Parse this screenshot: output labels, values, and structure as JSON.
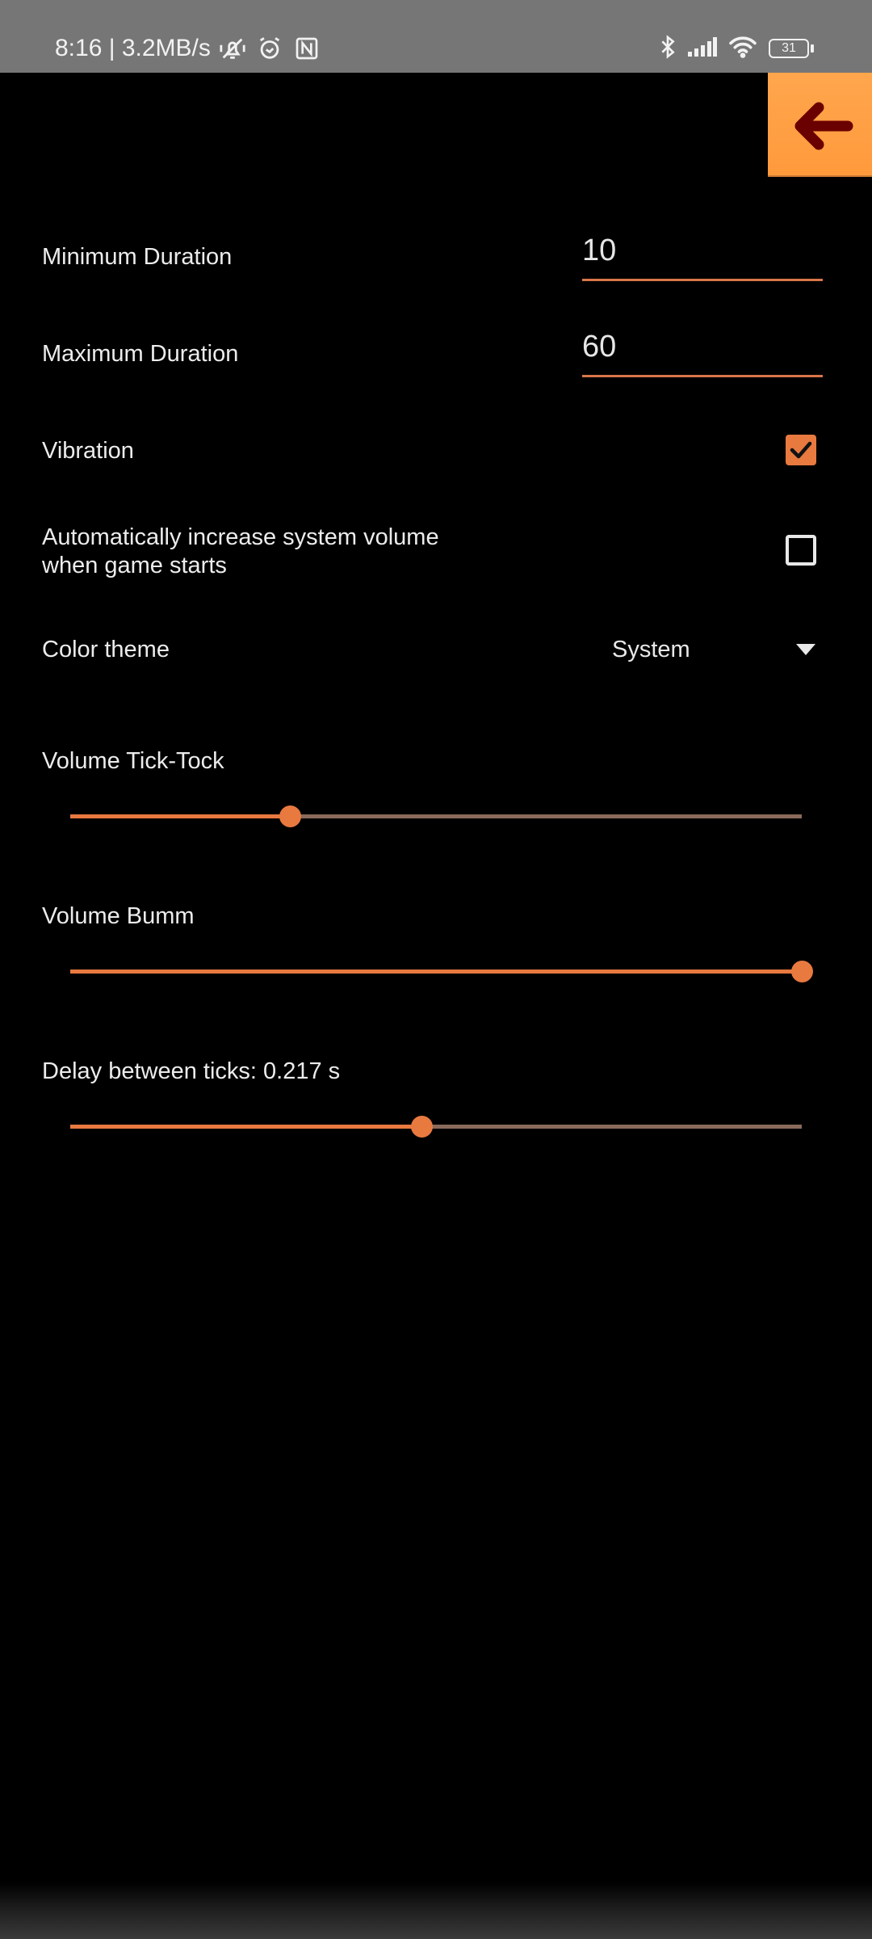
{
  "status_bar": {
    "time_speed": "8:16 | 3.2MB/s",
    "battery": "31",
    "icons": [
      "vibrate-off-icon",
      "alarm-icon",
      "nfc-icon",
      "bluetooth-icon",
      "signal-icon",
      "wifi-icon",
      "battery-icon"
    ]
  },
  "header": {
    "back_icon": "arrow-left-icon"
  },
  "settings": {
    "min_duration": {
      "label": "Minimum Duration",
      "value": "10"
    },
    "max_duration": {
      "label": "Maximum Duration",
      "value": "60"
    },
    "vibration": {
      "label": "Vibration",
      "checked": true
    },
    "auto_volume": {
      "label_line1": "Automatically increase system volume",
      "label_line2": "when game starts",
      "checked": false
    },
    "color_theme": {
      "label": "Color theme",
      "selected": "System"
    },
    "volume_ticktock": {
      "label": "Volume Tick-Tock",
      "value_fraction": 0.3
    },
    "volume_bumm": {
      "label": "Volume Bumm",
      "value_fraction": 1.0
    },
    "delay": {
      "label": "Delay between ticks: 0.217 s",
      "value_fraction": 0.48
    }
  },
  "colors": {
    "accent": "#e8793f",
    "track_inactive": "#8a6a5a",
    "back_button": "#ff9a3c",
    "back_arrow": "#6b0000",
    "status_bar": "#767676",
    "background": "#000000"
  }
}
